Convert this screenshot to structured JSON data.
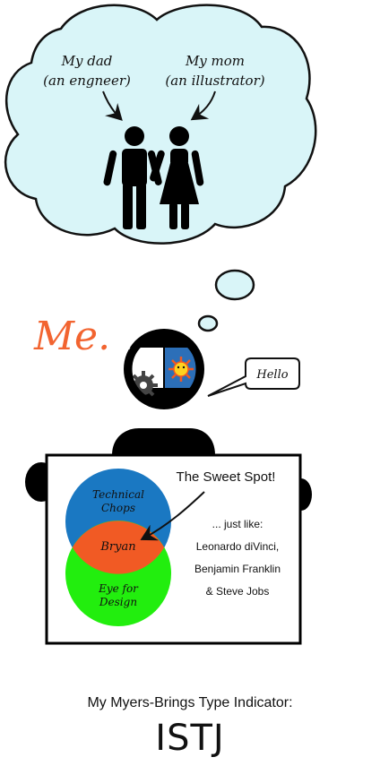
{
  "thought": {
    "dad_line1": "My dad",
    "dad_line2": "(an engneer)",
    "mom_line1": "My mom",
    "mom_line2": "(an illustrator)"
  },
  "me_label": "Me.",
  "speech": "Hello",
  "venn": {
    "top": [
      "Technical",
      "Chops"
    ],
    "center": "Bryan",
    "bottom": [
      "Eye for",
      "Design"
    ]
  },
  "sweet_spot": "The Sweet Spot!",
  "just_like": "... just like:",
  "people": [
    "Leonardo diVinci,",
    "Benjamin Franklin",
    "& Steve Jobs"
  ],
  "mbti": {
    "label": "My Myers-Brings Type Indicator:",
    "type": "ISTJ"
  },
  "colors": {
    "cloud_fill": "#d9f5f8",
    "me_orange": "#f26430",
    "venn_blue": "#1a78c2",
    "venn_green": "#22ee0e",
    "venn_orange": "#f15a24"
  },
  "icons": [
    "man-icon",
    "woman-icon",
    "gear-icon",
    "sun-illustration"
  ]
}
